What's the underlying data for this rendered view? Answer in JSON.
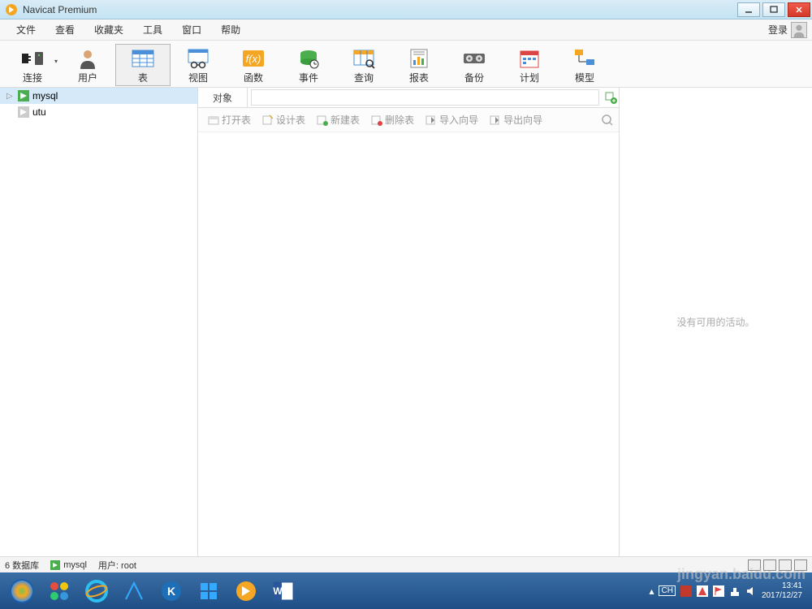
{
  "title": "Navicat Premium",
  "menu": {
    "items": [
      "文件",
      "查看",
      "收藏夹",
      "工具",
      "窗口",
      "帮助"
    ],
    "login": "登录"
  },
  "toolbar": [
    {
      "label": "连接",
      "icon": "plug",
      "drop": true
    },
    {
      "label": "用户",
      "icon": "user"
    },
    {
      "label": "表",
      "icon": "table",
      "active": true
    },
    {
      "label": "视图",
      "icon": "view"
    },
    {
      "label": "函数",
      "icon": "fx"
    },
    {
      "label": "事件",
      "icon": "event"
    },
    {
      "label": "查询",
      "icon": "query"
    },
    {
      "label": "报表",
      "icon": "report"
    },
    {
      "label": "备份",
      "icon": "backup"
    },
    {
      "label": "计划",
      "icon": "schedule"
    },
    {
      "label": "模型",
      "icon": "model"
    }
  ],
  "tree": [
    {
      "label": "mysql",
      "icon": "conn-green",
      "expanded": true,
      "selected": true
    },
    {
      "label": "utu",
      "icon": "conn-gray",
      "expanded": false,
      "selected": false
    }
  ],
  "pathbar": {
    "label": "对象"
  },
  "objbar": [
    "打开表",
    "设计表",
    "新建表",
    "删除表",
    "导入向导",
    "导出向导"
  ],
  "rightpanel": {
    "empty": "没有可用的活动。"
  },
  "statusbar": {
    "left": "6 数据库",
    "conn": "mysql",
    "user": "用户: root"
  },
  "tray": {
    "ime": "CH",
    "time": "13:41",
    "date": "2017/12/27"
  },
  "watermark": "jingyan.baidu.com"
}
